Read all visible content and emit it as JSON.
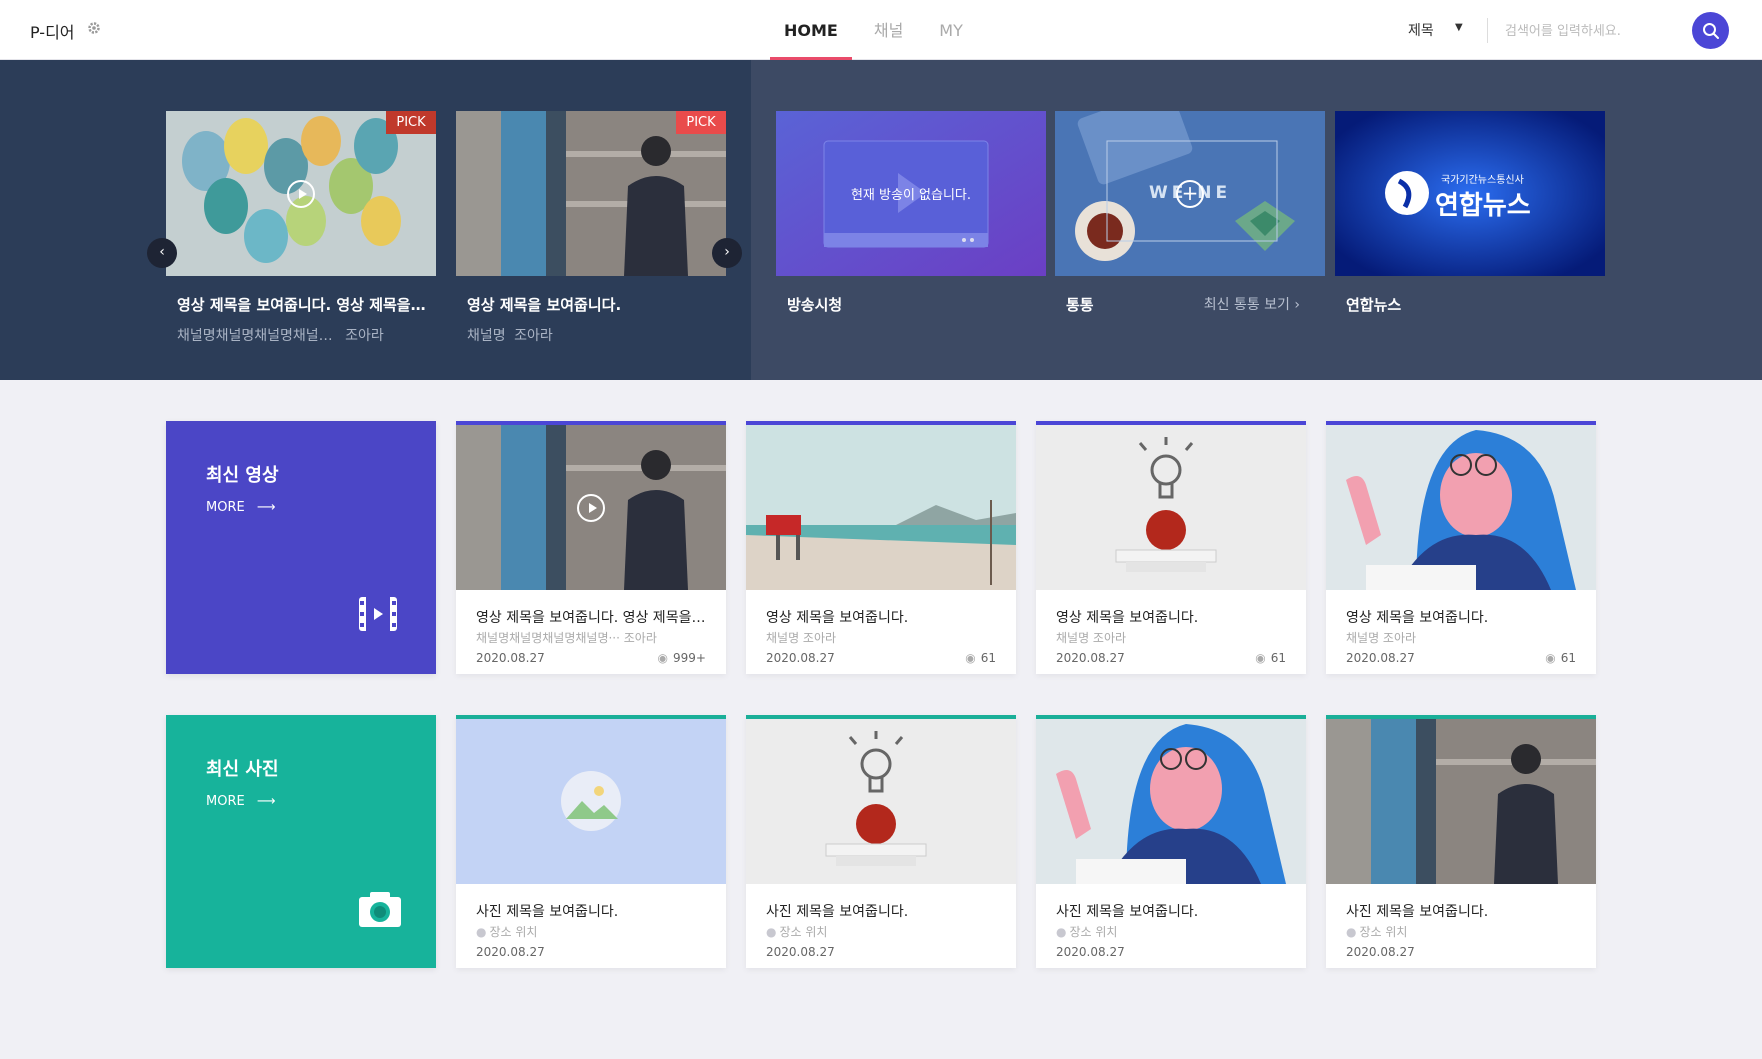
{
  "header": {
    "logo": "P-디어",
    "nav": [
      "HOME",
      "채널",
      "MY"
    ],
    "search_select": "제목",
    "search_placeholder": "검색어를 입력하세요."
  },
  "hero": {
    "pick_badge": "PICK",
    "cards": [
      {
        "title": "영상 제목을 보여줍니다. 영상 제목을 보여줍니다.",
        "channel": "채널명채널명채널명채널…",
        "views": "조아라"
      },
      {
        "title": "영상 제목을 보여줍니다.",
        "channel": "채널명",
        "views": "조아라"
      }
    ],
    "services": [
      {
        "title": "방송시청",
        "thumb_text": "현재 방송이 없습니다."
      },
      {
        "title": "통통",
        "link": "최신 통통 보기",
        "thumb_text": "WE NE"
      },
      {
        "title": "연합뉴스",
        "logo_sub": "국가기간뉴스통신사",
        "logo_main": "연합뉴스"
      }
    ]
  },
  "videos": {
    "title": "최신 영상",
    "more": "MORE",
    "accent": "#4b46d6",
    "items": [
      {
        "title": "영상 제목을 보여줍니다. 영상 제목을 보여줍니다.",
        "channel": "채널명채널명채널명채널명··· 조아라",
        "date": "2020.08.27",
        "views": "999+"
      },
      {
        "title": "영상 제목을 보여줍니다.",
        "channel": "채널명 조아라",
        "date": "2020.08.27",
        "views": "61"
      },
      {
        "title": "영상 제목을 보여줍니다.",
        "channel": "채널명 조아라",
        "date": "2020.08.27",
        "views": "61"
      },
      {
        "title": "영상 제목을 보여줍니다.",
        "channel": "채널명 조아라",
        "date": "2020.08.27",
        "views": "61"
      }
    ]
  },
  "photos": {
    "title": "최신 사진",
    "more": "MORE",
    "accent": "#1aaf98",
    "items": [
      {
        "title": "사진 제목을 보여줍니다.",
        "location": "장소 위치",
        "date": "2020.08.27"
      },
      {
        "title": "사진 제목을 보여줍니다.",
        "location": "장소 위치",
        "date": "2020.08.27"
      },
      {
        "title": "사진 제목을 보여줍니다.",
        "location": "장소 위치",
        "date": "2020.08.27"
      },
      {
        "title": "사진 제목을 보여줍니다.",
        "location": "장소 위치",
        "date": "2020.08.27"
      }
    ]
  }
}
